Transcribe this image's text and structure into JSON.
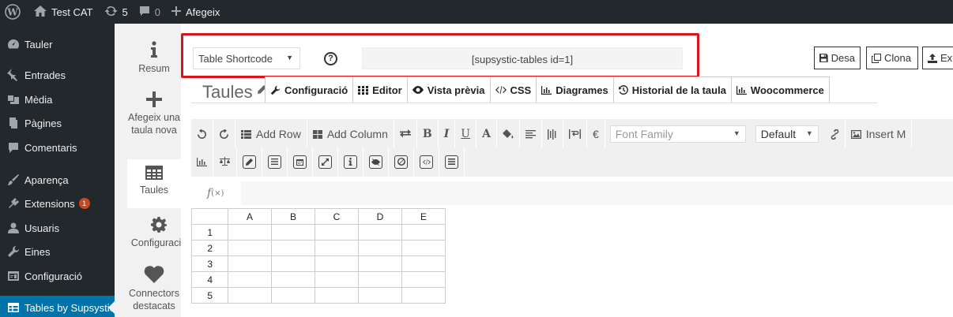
{
  "adminbar": {
    "site_name": "Test CAT",
    "updates_count": "5",
    "comments_count": "0",
    "new_label": "Afegeix"
  },
  "adminmenu": {
    "items": [
      {
        "label": "Tauler",
        "icon": "dashboard-icon"
      },
      {
        "label": "Entrades",
        "icon": "pin-icon"
      },
      {
        "label": "Mèdia",
        "icon": "media-icon"
      },
      {
        "label": "Pàgines",
        "icon": "pages-icon"
      },
      {
        "label": "Comentaris",
        "icon": "comment-icon"
      },
      {
        "label": "Aparença",
        "icon": "brush-icon"
      },
      {
        "label": "Extensions",
        "icon": "plugin-icon",
        "badge": "1"
      },
      {
        "label": "Usuaris",
        "icon": "user-icon"
      },
      {
        "label": "Eines",
        "icon": "wrench-icon"
      },
      {
        "label": "Configuració",
        "icon": "settings-icon"
      },
      {
        "label": "Tables by Supsystic",
        "icon": "table-icon"
      }
    ]
  },
  "plugin_nav": {
    "items": [
      {
        "label": "Resum",
        "icon": "info-icon"
      },
      {
        "label": "Afegeix una taula nova",
        "icon": "plus-icon"
      },
      {
        "label": "Taules",
        "icon": "grid-icon"
      },
      {
        "label": "Configuració",
        "icon": "gear-icon"
      },
      {
        "label": "Connectors destacats",
        "icon": "heart-icon"
      }
    ]
  },
  "shortcode": {
    "select_value": "Table Shortcode",
    "help": "?",
    "value": "[supsystic-tables id=1]"
  },
  "actions": {
    "save": "Desa",
    "clone": "Clona",
    "export": "Ex"
  },
  "page": {
    "title": "Taules"
  },
  "tabs": [
    {
      "label": "Configuració",
      "icon": "wrench-icon"
    },
    {
      "label": "Editor",
      "icon": "grid-icon"
    },
    {
      "label": "Vista prèvia",
      "icon": "eye-icon"
    },
    {
      "label": "CSS",
      "icon": "code-icon"
    },
    {
      "label": "Diagrames",
      "icon": "bar-chart-icon"
    },
    {
      "label": "Historial de la taula",
      "icon": "history-icon"
    },
    {
      "label": "Woocommerce",
      "icon": "bar-chart-icon"
    }
  ],
  "toolbar": {
    "add_row": "Add Row",
    "add_column": "Add Column",
    "bold": "B",
    "italic": "I",
    "underline": "U",
    "font_color": "A",
    "currency": "€",
    "font_family": "Font Family",
    "font_size": "Default",
    "insert_media": "Insert M"
  },
  "formula": {
    "label": "f",
    "sub": "(×)"
  },
  "grid": {
    "columns": [
      "A",
      "B",
      "C",
      "D",
      "E"
    ],
    "rows": [
      "1",
      "2",
      "3",
      "4",
      "5"
    ]
  }
}
